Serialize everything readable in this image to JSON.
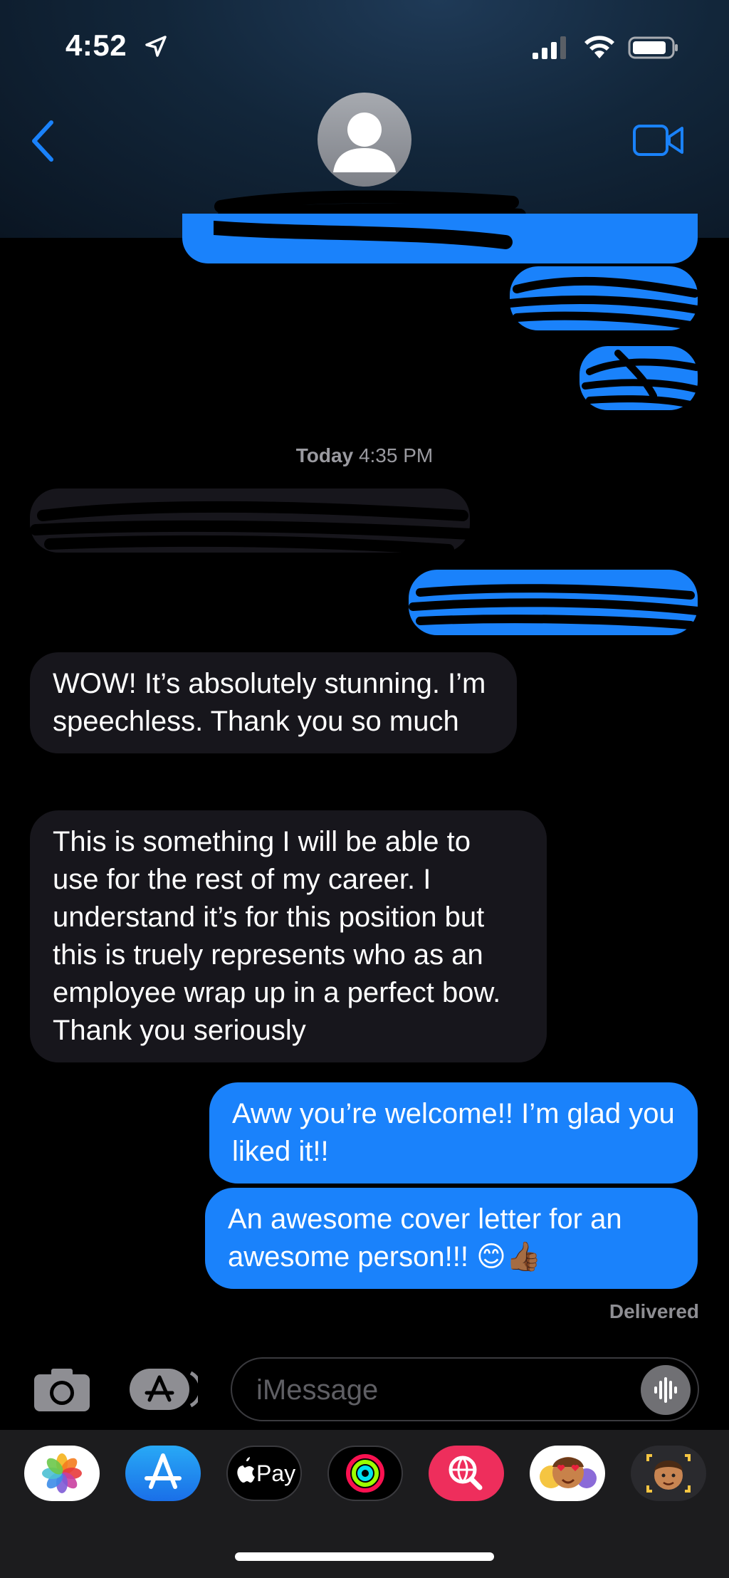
{
  "status_bar": {
    "time": "4:52"
  },
  "conversation": {
    "timestamp_day": "Today",
    "timestamp_time": "4:35 PM",
    "messages": [
      {
        "direction": "incoming",
        "text": "WOW! It’s absolutely stunning. I’m speechless. Thank you so much"
      },
      {
        "direction": "incoming",
        "text": "This is something I will be able to use for the rest of my career. I understand it’s for this position but this is truely represents who as an employee wrap up in a perfect bow. Thank you seriously"
      },
      {
        "direction": "outgoing",
        "text": "Aww you’re welcome!! I’m glad you liked it!!"
      },
      {
        "direction": "outgoing",
        "text": "An awesome cover letter for an awesome person!!! 😊👍🏾"
      }
    ],
    "delivery_status": "Delivered"
  },
  "input": {
    "placeholder": "iMessage"
  },
  "app_drawer": {
    "apps": [
      "photos-icon",
      "app-store-icon",
      "apple-pay-icon",
      "activity-icon",
      "images-search-icon",
      "memoji-stickers-icon",
      "memoji-icon"
    ],
    "apple_pay_label": "Pay"
  },
  "colors": {
    "outgoing_bubble": "#1a82fb",
    "incoming_bubble": "#17161c",
    "accent": "#1a82fb"
  }
}
